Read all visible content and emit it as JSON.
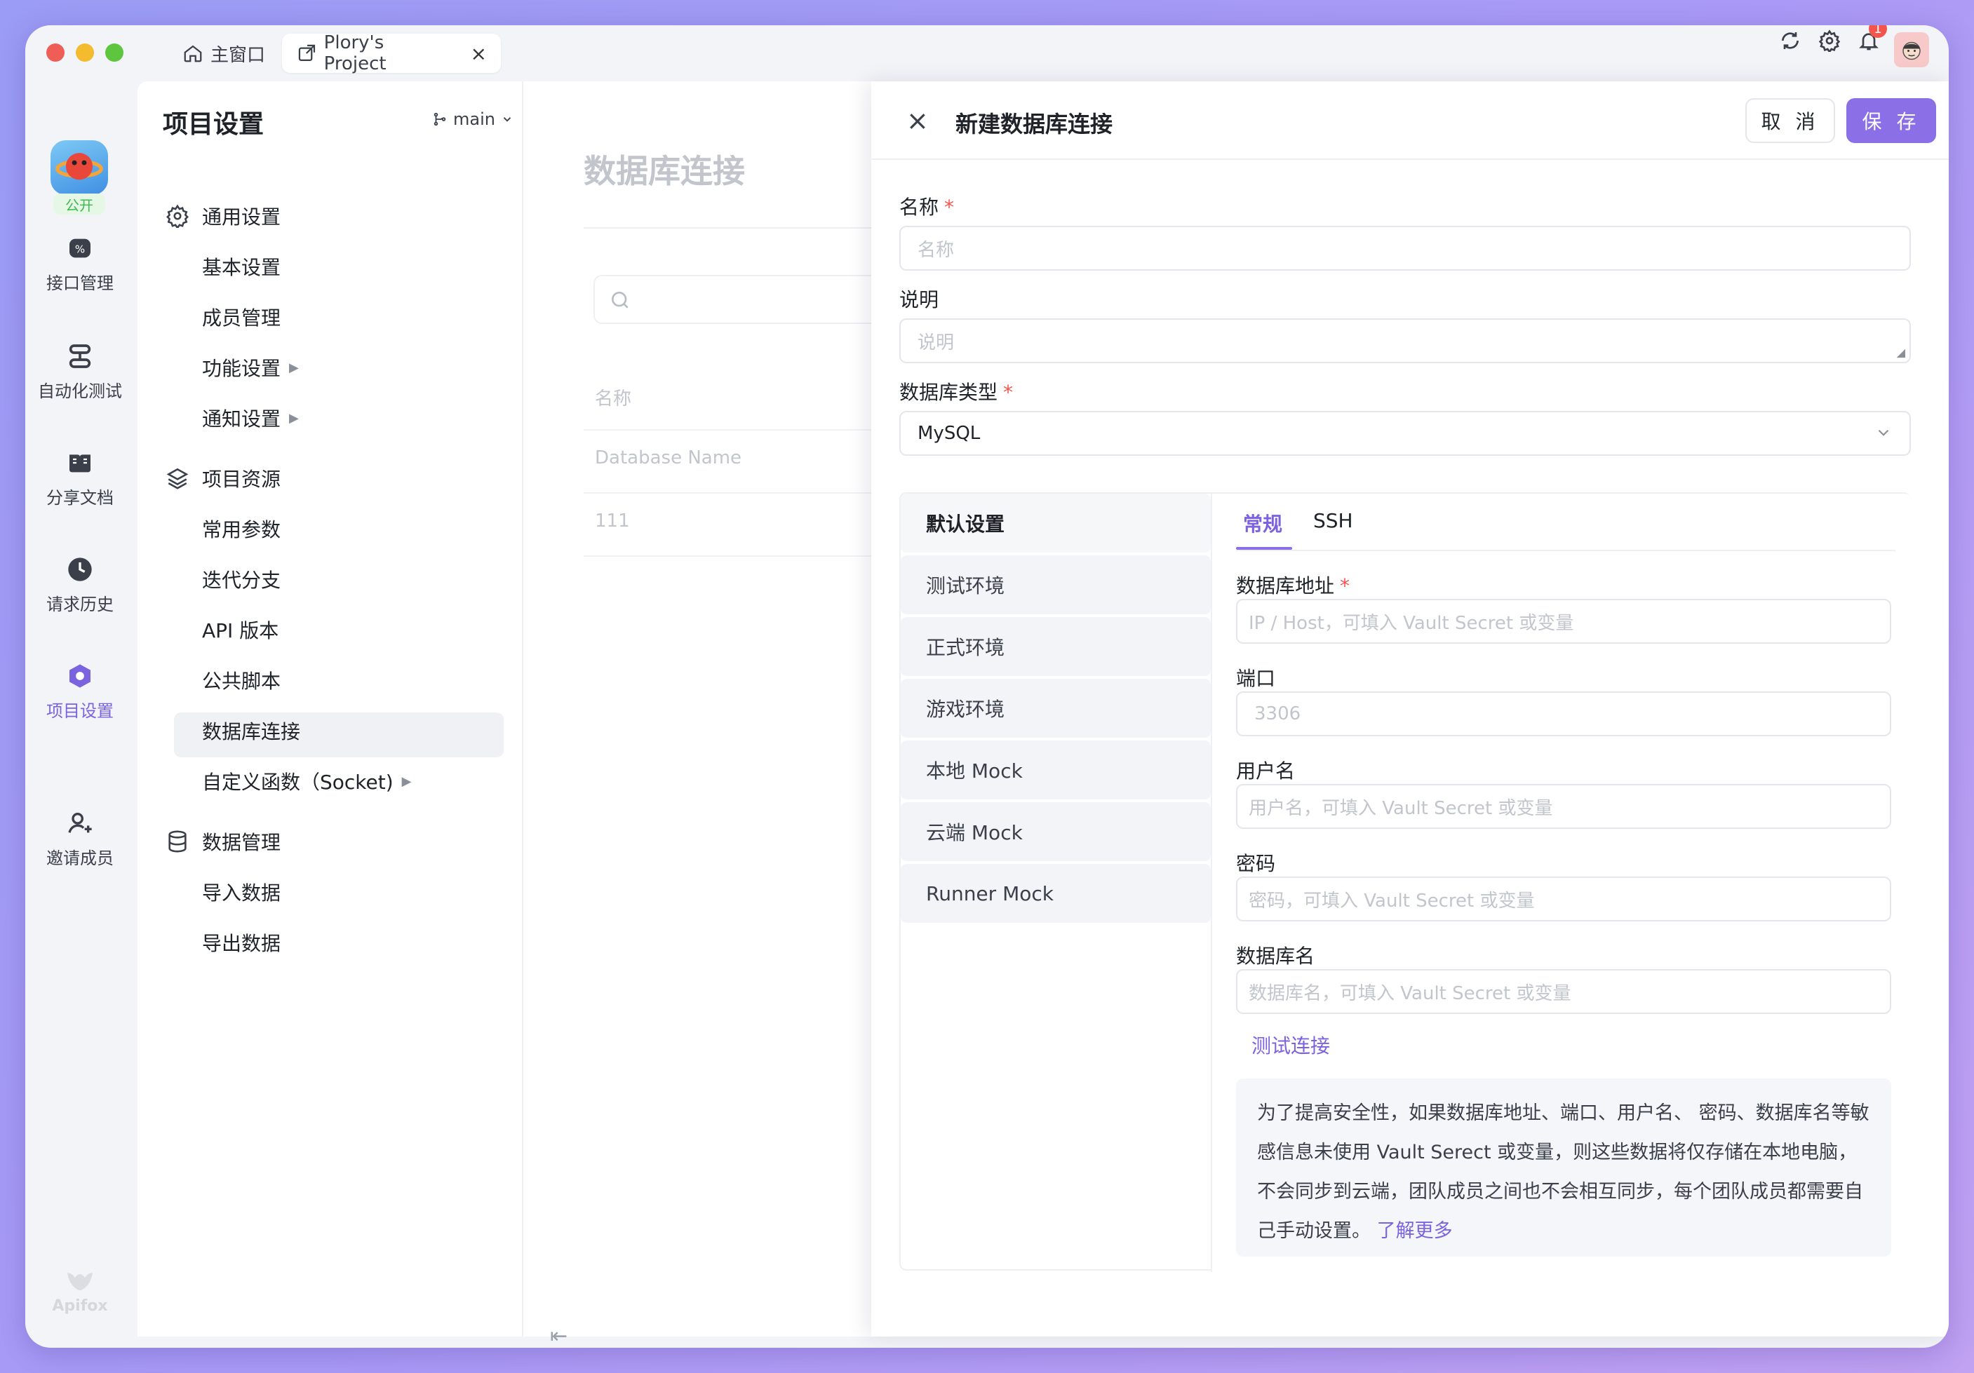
{
  "tabs": {
    "home_label": "主窗口",
    "project_label": "Plory's Project",
    "close_symbol": "×"
  },
  "topbar": {
    "notification_count": "1",
    "icons": [
      "refresh-icon",
      "gear-icon",
      "bell-icon",
      "user-avatar"
    ]
  },
  "rail": {
    "project_badge": "公开",
    "items": [
      {
        "label": "接口管理",
        "icon": "api-icon"
      },
      {
        "label": "自动化测试",
        "icon": "automation-icon"
      },
      {
        "label": "分享文档",
        "icon": "book-icon"
      },
      {
        "label": "请求历史",
        "icon": "clock-icon"
      },
      {
        "label": "项目设置",
        "icon": "hexagon-icon",
        "active": true
      },
      {
        "label": "邀请成员",
        "icon": "add-user-icon"
      }
    ],
    "brand": "Apifox"
  },
  "sidebar": {
    "title": "项目设置",
    "branch": "main",
    "groups": [
      {
        "label": "通用设置",
        "icon": "gear-icon",
        "items": [
          "基本设置",
          "成员管理",
          "功能设置",
          "通知设置"
        ]
      },
      {
        "label": "项目资源",
        "icon": "layers-icon",
        "items": [
          "常用参数",
          "迭代分支",
          "API 版本",
          "公共脚本",
          "数据库连接",
          "自定义函数（Socket)"
        ]
      },
      {
        "label": "数据管理",
        "icon": "database-icon",
        "items": [
          "导入数据",
          "导出数据"
        ]
      }
    ],
    "active_item": "数据库连接"
  },
  "content": {
    "title": "数据库连接",
    "col_name": "名称",
    "row_header": "Database Name",
    "row_value": "111",
    "collapse_symbol": "⇤"
  },
  "drawer": {
    "title": "新建数据库连接",
    "close_symbol": "×",
    "cancel_label": "取 消",
    "save_label": "保 存",
    "name_label": "名称",
    "name_placeholder": "名称",
    "desc_label": "说明",
    "desc_placeholder": "说明",
    "dbtype_label": "数据库类型",
    "dbtype_value": "MySQL",
    "required_mark": "*",
    "environments": [
      "默认设置",
      "测试环境",
      "正式环境",
      "游戏环境",
      "本地 Mock",
      "云端 Mock",
      "Runner Mock"
    ],
    "panel_tabs": [
      "常规",
      "SSH"
    ],
    "host_label": "数据库地址",
    "host_placeholder": "IP / Host，可填入 Vault Secret 或变量",
    "port_label": "端口",
    "port_placeholder": "3306",
    "user_label": "用户名",
    "user_placeholder": "用户名，可填入 Vault Secret 或变量",
    "pass_label": "密码",
    "pass_placeholder": "密码，可填入 Vault Secret 或变量",
    "dbname_label": "数据库名",
    "dbname_placeholder": "数据库名，可填入 Vault Secret 或变量",
    "test_link": "测试连接",
    "notice_text": "为了提高安全性，如果数据库地址、端口、用户名、 密码、数据库名等敏感信息未使用 Vault Serect 或变量，则这些数据将仅存储在本地电脑，不会同步到云端，团队成员之间也不会相互同步，每个团队成员都需要自己手动设置。",
    "notice_link": "了解更多"
  },
  "colors": {
    "accent": "#8b6fe6",
    "required": "#f5544d",
    "public_badge": "#3fb950"
  }
}
